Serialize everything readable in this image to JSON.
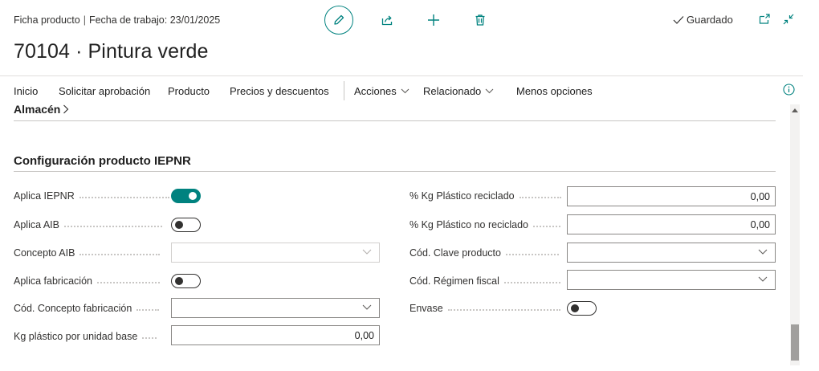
{
  "header": {
    "breadcrumb_page": "Ficha producto",
    "breadcrumb_sep": "|",
    "breadcrumb_date": "Fecha de trabajo: 23/01/2025",
    "saved_label": "Guardado",
    "title": "70104 · Pintura verde"
  },
  "actionbar": {
    "items": [
      "Inicio",
      "Solicitar aprobación",
      "Producto",
      "Precios y descuentos"
    ],
    "menus": [
      "Acciones",
      "Relacionado"
    ],
    "less_options": "Menos opciones"
  },
  "sections": {
    "almacen": "Almacén",
    "config_title": "Configuración producto IEPNR"
  },
  "left_fields": {
    "aplica_iepnr": {
      "label": "Aplica IEPNR",
      "value": true
    },
    "aplica_aib": {
      "label": "Aplica AIB",
      "value": false
    },
    "concepto_aib": {
      "label": "Concepto AIB",
      "value": ""
    },
    "aplica_fabricacion": {
      "label": "Aplica fabricación",
      "value": false
    },
    "cod_concepto_fabricacion": {
      "label": "Cód. Concepto fabricación",
      "value": ""
    },
    "kg_plastico": {
      "label": "Kg plástico por unidad base",
      "value": "0,00"
    }
  },
  "right_fields": {
    "pct_reciclado": {
      "label": "% Kg Plástico reciclado",
      "value": "0,00"
    },
    "pct_no_reciclado": {
      "label": "% Kg Plástico no reciclado",
      "value": "0,00"
    },
    "cod_clave": {
      "label": "Cód. Clave producto",
      "value": ""
    },
    "cod_regimen": {
      "label": "Cód. Régimen fiscal",
      "value": ""
    },
    "envase": {
      "label": "Envase",
      "value": false
    }
  },
  "colors": {
    "accent": "#00827f",
    "text": "#212121",
    "border": "#8a8886"
  },
  "icons": [
    "edit-icon",
    "share-icon",
    "add-icon",
    "delete-icon",
    "check-icon",
    "open-new-window-icon",
    "collapse-icon",
    "info-icon",
    "chevron-right-icon",
    "chevron-down-icon",
    "scroll-up-icon"
  ]
}
